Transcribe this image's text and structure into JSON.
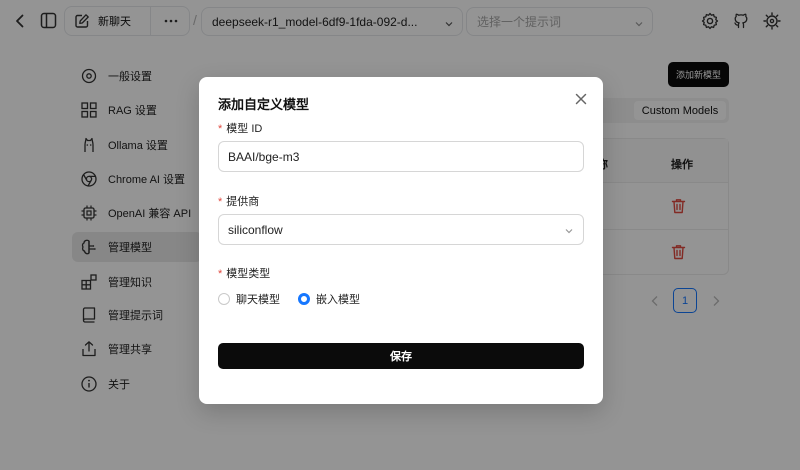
{
  "topbar": {
    "new_chat_label": "新聊天",
    "model_select_value": "deepseek-r1_model-6df9-1fda-092-d...",
    "prompt_select_placeholder": "选择一个提示词",
    "separator": "/"
  },
  "sidebar": {
    "items": [
      {
        "label": "一般设置",
        "icon": "settings-cog-icon"
      },
      {
        "label": "RAG 设置",
        "icon": "rag-icon"
      },
      {
        "label": "Ollama 设置",
        "icon": "ollama-icon"
      },
      {
        "label": "Chrome AI 设置",
        "icon": "chrome-icon"
      },
      {
        "label": "OpenAI 兼容 API",
        "icon": "chip-icon"
      },
      {
        "label": "管理模型",
        "icon": "brain-icon",
        "active": true
      },
      {
        "label": "管理知识",
        "icon": "blocks-icon"
      },
      {
        "label": "管理提示词",
        "icon": "book-icon"
      },
      {
        "label": "管理共享",
        "icon": "share-icon"
      },
      {
        "label": "关于",
        "icon": "info-icon"
      }
    ]
  },
  "main": {
    "add_model_button": "添加新模型",
    "tabs": [
      {
        "label": "odels"
      },
      {
        "label": "Custom Models",
        "active": true
      }
    ],
    "table": {
      "col_partial": "称",
      "col_actions": "操作"
    },
    "pagination": {
      "current_page": "1"
    }
  },
  "modal": {
    "title": "添加自定义模型",
    "fields": {
      "model_id": {
        "label": "模型 ID",
        "value": "BAAI/bge-m3"
      },
      "provider": {
        "label": "提供商",
        "value": "siliconflow"
      },
      "model_type": {
        "label": "模型类型",
        "options": [
          {
            "label": "聊天模型",
            "checked": false
          },
          {
            "label": "嵌入模型",
            "checked": true
          }
        ]
      }
    },
    "required_mark": "*",
    "save_label": "保存"
  },
  "colors": {
    "accent": "#1677ff",
    "danger": "#e0493f",
    "primary_button": "#0b0b0b"
  }
}
